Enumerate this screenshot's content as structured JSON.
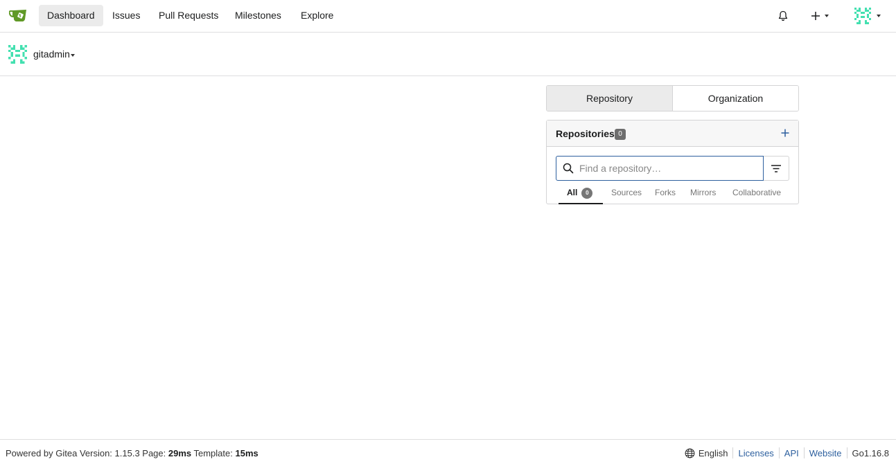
{
  "nav": {
    "items": [
      {
        "label": "Dashboard",
        "active": true
      },
      {
        "label": "Issues"
      },
      {
        "label": "Pull Requests"
      },
      {
        "label": "Milestones"
      },
      {
        "label": "Explore"
      }
    ],
    "bell_icon": "bell-icon",
    "create_icon": "plus-icon",
    "avatar_icon": "identicon-avatar"
  },
  "header": {
    "username": "gitadmin"
  },
  "tabs": [
    {
      "label": "Repository",
      "active": true
    },
    {
      "label": "Organization"
    }
  ],
  "repos": {
    "title": "Repositories",
    "count": "0",
    "search_placeholder": "Find a repository…",
    "subtabs": [
      {
        "label": "All",
        "count": "0",
        "active": true
      },
      {
        "label": "Sources"
      },
      {
        "label": "Forks"
      },
      {
        "label": "Mirrors"
      },
      {
        "label": "Collaborative"
      }
    ]
  },
  "footer": {
    "powered_by": "Powered by Gitea Version: 1.15.3 Page: ",
    "page_time": "29ms",
    "template_label": " Template: ",
    "template_time": "15ms",
    "language": "English",
    "links": [
      "Licenses",
      "API",
      "Website"
    ],
    "go_version": "Go1.16.8"
  },
  "colors": {
    "brand_green": "#609926",
    "link_blue": "#2c5f9e",
    "avatar_teal": "#43e0b0"
  }
}
